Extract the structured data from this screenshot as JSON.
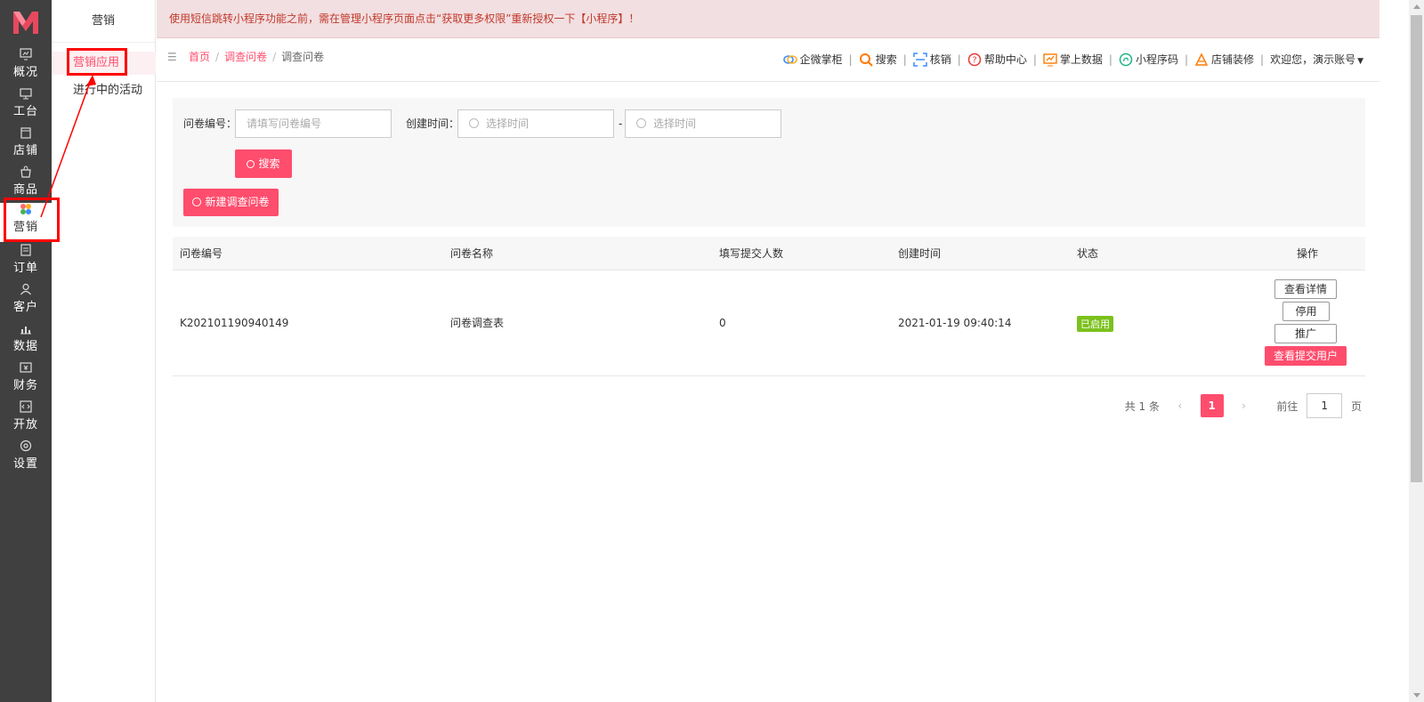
{
  "nav": {
    "items": [
      {
        "label": "概况",
        "icon": "overview-icon"
      },
      {
        "label": "工台",
        "icon": "workbench-icon"
      },
      {
        "label": "店铺",
        "icon": "store-icon"
      },
      {
        "label": "商品",
        "icon": "product-icon"
      },
      {
        "label": "营销",
        "icon": "marketing-icon"
      },
      {
        "label": "订单",
        "icon": "order-icon"
      },
      {
        "label": "客户",
        "icon": "customer-icon"
      },
      {
        "label": "数据",
        "icon": "data-icon"
      },
      {
        "label": "财务",
        "icon": "finance-icon"
      },
      {
        "label": "开放",
        "icon": "open-icon"
      },
      {
        "label": "设置",
        "icon": "settings-icon"
      }
    ]
  },
  "subnav": {
    "title": "营销",
    "items": [
      {
        "label": "营销应用"
      },
      {
        "label": "进行中的活动"
      }
    ]
  },
  "notice": "使用短信跳转小程序功能之前，需在管理小程序页面点击“获取更多权限”重新授权一下【小程序】！",
  "breadcrumb": {
    "home": "首页",
    "parent": "调查问卷",
    "current": "调查问卷",
    "sep": "/"
  },
  "toolbar": {
    "items": [
      {
        "label": "企微掌柜",
        "icon": "wecom-icon"
      },
      {
        "label": "搜索",
        "icon": "search-icon"
      },
      {
        "label": "核销",
        "icon": "scan-icon"
      },
      {
        "label": "帮助中心",
        "icon": "help-icon"
      },
      {
        "label": "掌上数据",
        "icon": "chart-icon"
      },
      {
        "label": "小程序码",
        "icon": "miniprogram-icon"
      },
      {
        "label": "店铺装修",
        "icon": "decorate-icon"
      }
    ],
    "user": "欢迎您，演示账号"
  },
  "filter": {
    "id_label": "问卷编号：",
    "id_placeholder": "请填写问卷编号",
    "time_label": "创建时间：",
    "start_placeholder": "选择时间",
    "end_placeholder": "选择时间",
    "range_sep": "-",
    "search_btn": "搜索",
    "new_btn": "新建调查问卷"
  },
  "table": {
    "headers": [
      "问卷编号",
      "问卷名称",
      "填写提交人数",
      "创建时间",
      "状态",
      "操作"
    ],
    "rows": [
      {
        "id": "K202101190940149",
        "name": "问卷调查表",
        "count": "0",
        "created": "2021-01-19 09:40:14",
        "status": "已启用",
        "actions": [
          "查看详情",
          "停用",
          "推广",
          "查看提交用户"
        ]
      }
    ]
  },
  "pagination": {
    "total": "共 1 条",
    "current": "1",
    "goto_label": "前往",
    "goto_value": "1",
    "page_suffix": "页"
  },
  "colors": {
    "accent": "#ff4d6d",
    "nav_bg": "#404040",
    "status_green": "#7bc11d",
    "highlight_red": "#ff0000"
  }
}
